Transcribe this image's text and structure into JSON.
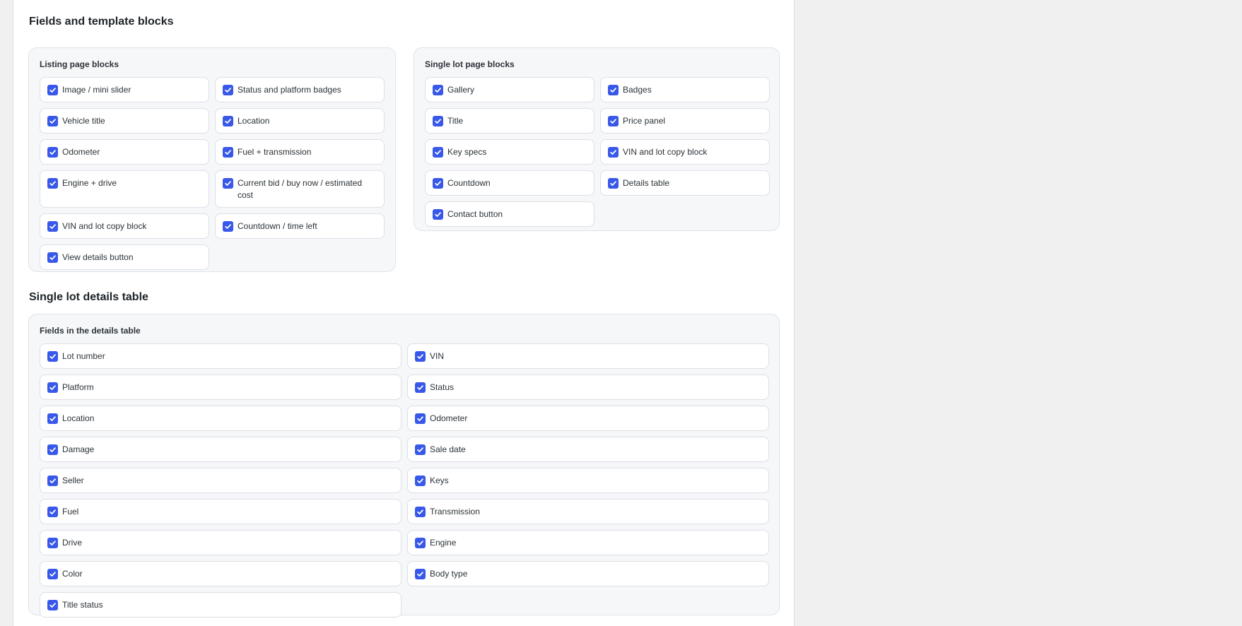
{
  "fields_section": {
    "title": "Fields and template blocks",
    "listing": {
      "title": "Listing page blocks",
      "items": [
        {
          "label": "Image / mini slider",
          "checked": true
        },
        {
          "label": "Status and platform badges",
          "checked": true
        },
        {
          "label": "Vehicle title",
          "checked": true
        },
        {
          "label": "Location",
          "checked": true
        },
        {
          "label": "Odometer",
          "checked": true
        },
        {
          "label": "Fuel + transmission",
          "checked": true
        },
        {
          "label": "Engine + drive",
          "checked": true
        },
        {
          "label": "Current bid / buy now / estimated cost",
          "checked": true
        },
        {
          "label": "VIN and lot copy block",
          "checked": true
        },
        {
          "label": "Countdown / time left",
          "checked": true
        },
        {
          "label": "View details button",
          "checked": true
        }
      ]
    },
    "single": {
      "title": "Single lot page blocks",
      "items": [
        {
          "label": "Gallery",
          "checked": true
        },
        {
          "label": "Badges",
          "checked": true
        },
        {
          "label": "Title",
          "checked": true
        },
        {
          "label": "Price panel",
          "checked": true
        },
        {
          "label": "Key specs",
          "checked": true
        },
        {
          "label": "VIN and lot copy block",
          "checked": true
        },
        {
          "label": "Countdown",
          "checked": true
        },
        {
          "label": "Details table",
          "checked": true
        },
        {
          "label": "Contact button",
          "checked": true
        }
      ]
    }
  },
  "details_section": {
    "title": "Single lot details table",
    "box": {
      "title": "Fields in the details table",
      "items": [
        {
          "label": "Lot number",
          "checked": true
        },
        {
          "label": "VIN",
          "checked": true
        },
        {
          "label": "Platform",
          "checked": true
        },
        {
          "label": "Status",
          "checked": true
        },
        {
          "label": "Location",
          "checked": true
        },
        {
          "label": "Odometer",
          "checked": true
        },
        {
          "label": "Damage",
          "checked": true
        },
        {
          "label": "Sale date",
          "checked": true
        },
        {
          "label": "Seller",
          "checked": true
        },
        {
          "label": "Keys",
          "checked": true
        },
        {
          "label": "Fuel",
          "checked": true
        },
        {
          "label": "Transmission",
          "checked": true
        },
        {
          "label": "Drive",
          "checked": true
        },
        {
          "label": "Engine",
          "checked": true
        },
        {
          "label": "Color",
          "checked": true
        },
        {
          "label": "Body type",
          "checked": true
        },
        {
          "label": "Title status",
          "checked": true
        }
      ]
    }
  },
  "colors": {
    "checkbox": "#3858e9",
    "box_background": "#f6f7f9",
    "page_background": "#f0f0f1"
  },
  "icons": {
    "checkbox": "checkmark-icon"
  }
}
